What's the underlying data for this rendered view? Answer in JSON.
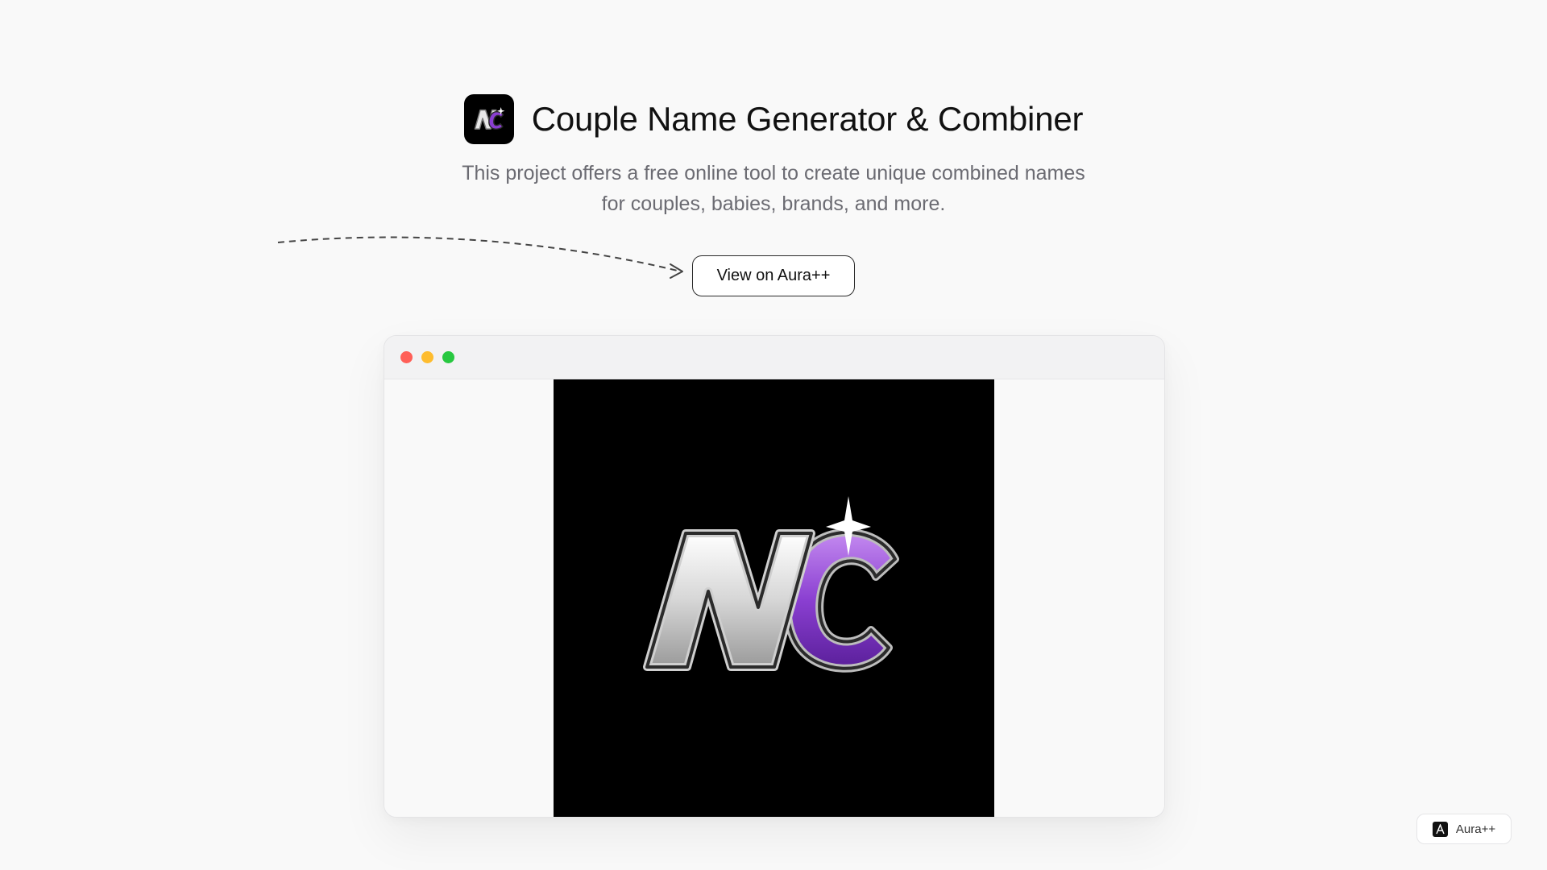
{
  "header": {
    "title": "Couple Name Generator & Combiner",
    "subtitle": "This project offers a free online tool to create unique combined names for couples, babies, brands, and more.",
    "app_icon": "nc-logo-icon"
  },
  "cta": {
    "label": "View on Aura++"
  },
  "browser": {
    "controls": [
      {
        "name": "close",
        "color": "#ff5f57"
      },
      {
        "name": "minimize",
        "color": "#febc2e"
      },
      {
        "name": "maximize",
        "color": "#28c840"
      }
    ],
    "preview_logo": "nc-logo-icon"
  },
  "badge": {
    "label": "Aura++",
    "icon": "aura-logo-icon"
  },
  "colors": {
    "background": "#f9f9f9",
    "logo_purple": "#8a3fd1",
    "logo_silver": "#d9d9d9"
  }
}
